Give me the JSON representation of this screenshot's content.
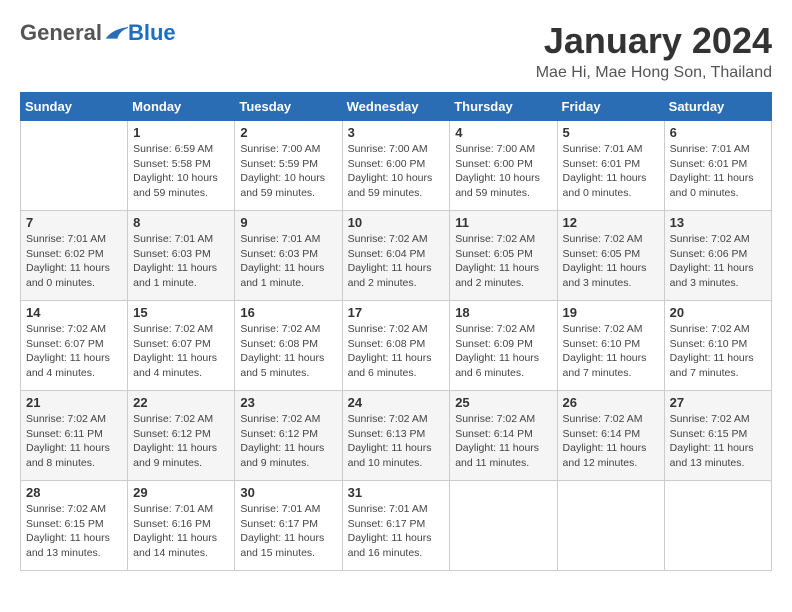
{
  "logo": {
    "general": "General",
    "blue": "Blue"
  },
  "title": "January 2024",
  "subtitle": "Mae Hi, Mae Hong Son, Thailand",
  "days_header": [
    "Sunday",
    "Monday",
    "Tuesday",
    "Wednesday",
    "Thursday",
    "Friday",
    "Saturday"
  ],
  "weeks": [
    [
      {
        "day": "",
        "info": ""
      },
      {
        "day": "1",
        "info": "Sunrise: 6:59 AM\nSunset: 5:58 PM\nDaylight: 10 hours\nand 59 minutes."
      },
      {
        "day": "2",
        "info": "Sunrise: 7:00 AM\nSunset: 5:59 PM\nDaylight: 10 hours\nand 59 minutes."
      },
      {
        "day": "3",
        "info": "Sunrise: 7:00 AM\nSunset: 6:00 PM\nDaylight: 10 hours\nand 59 minutes."
      },
      {
        "day": "4",
        "info": "Sunrise: 7:00 AM\nSunset: 6:00 PM\nDaylight: 10 hours\nand 59 minutes."
      },
      {
        "day": "5",
        "info": "Sunrise: 7:01 AM\nSunset: 6:01 PM\nDaylight: 11 hours\nand 0 minutes."
      },
      {
        "day": "6",
        "info": "Sunrise: 7:01 AM\nSunset: 6:01 PM\nDaylight: 11 hours\nand 0 minutes."
      }
    ],
    [
      {
        "day": "7",
        "info": "Sunrise: 7:01 AM\nSunset: 6:02 PM\nDaylight: 11 hours\nand 0 minutes."
      },
      {
        "day": "8",
        "info": "Sunrise: 7:01 AM\nSunset: 6:03 PM\nDaylight: 11 hours\nand 1 minute."
      },
      {
        "day": "9",
        "info": "Sunrise: 7:01 AM\nSunset: 6:03 PM\nDaylight: 11 hours\nand 1 minute."
      },
      {
        "day": "10",
        "info": "Sunrise: 7:02 AM\nSunset: 6:04 PM\nDaylight: 11 hours\nand 2 minutes."
      },
      {
        "day": "11",
        "info": "Sunrise: 7:02 AM\nSunset: 6:05 PM\nDaylight: 11 hours\nand 2 minutes."
      },
      {
        "day": "12",
        "info": "Sunrise: 7:02 AM\nSunset: 6:05 PM\nDaylight: 11 hours\nand 3 minutes."
      },
      {
        "day": "13",
        "info": "Sunrise: 7:02 AM\nSunset: 6:06 PM\nDaylight: 11 hours\nand 3 minutes."
      }
    ],
    [
      {
        "day": "14",
        "info": "Sunrise: 7:02 AM\nSunset: 6:07 PM\nDaylight: 11 hours\nand 4 minutes."
      },
      {
        "day": "15",
        "info": "Sunrise: 7:02 AM\nSunset: 6:07 PM\nDaylight: 11 hours\nand 4 minutes."
      },
      {
        "day": "16",
        "info": "Sunrise: 7:02 AM\nSunset: 6:08 PM\nDaylight: 11 hours\nand 5 minutes."
      },
      {
        "day": "17",
        "info": "Sunrise: 7:02 AM\nSunset: 6:08 PM\nDaylight: 11 hours\nand 6 minutes."
      },
      {
        "day": "18",
        "info": "Sunrise: 7:02 AM\nSunset: 6:09 PM\nDaylight: 11 hours\nand 6 minutes."
      },
      {
        "day": "19",
        "info": "Sunrise: 7:02 AM\nSunset: 6:10 PM\nDaylight: 11 hours\nand 7 minutes."
      },
      {
        "day": "20",
        "info": "Sunrise: 7:02 AM\nSunset: 6:10 PM\nDaylight: 11 hours\nand 7 minutes."
      }
    ],
    [
      {
        "day": "21",
        "info": "Sunrise: 7:02 AM\nSunset: 6:11 PM\nDaylight: 11 hours\nand 8 minutes."
      },
      {
        "day": "22",
        "info": "Sunrise: 7:02 AM\nSunset: 6:12 PM\nDaylight: 11 hours\nand 9 minutes."
      },
      {
        "day": "23",
        "info": "Sunrise: 7:02 AM\nSunset: 6:12 PM\nDaylight: 11 hours\nand 9 minutes."
      },
      {
        "day": "24",
        "info": "Sunrise: 7:02 AM\nSunset: 6:13 PM\nDaylight: 11 hours\nand 10 minutes."
      },
      {
        "day": "25",
        "info": "Sunrise: 7:02 AM\nSunset: 6:14 PM\nDaylight: 11 hours\nand 11 minutes."
      },
      {
        "day": "26",
        "info": "Sunrise: 7:02 AM\nSunset: 6:14 PM\nDaylight: 11 hours\nand 12 minutes."
      },
      {
        "day": "27",
        "info": "Sunrise: 7:02 AM\nSunset: 6:15 PM\nDaylight: 11 hours\nand 13 minutes."
      }
    ],
    [
      {
        "day": "28",
        "info": "Sunrise: 7:02 AM\nSunset: 6:15 PM\nDaylight: 11 hours\nand 13 minutes."
      },
      {
        "day": "29",
        "info": "Sunrise: 7:01 AM\nSunset: 6:16 PM\nDaylight: 11 hours\nand 14 minutes."
      },
      {
        "day": "30",
        "info": "Sunrise: 7:01 AM\nSunset: 6:17 PM\nDaylight: 11 hours\nand 15 minutes."
      },
      {
        "day": "31",
        "info": "Sunrise: 7:01 AM\nSunset: 6:17 PM\nDaylight: 11 hours\nand 16 minutes."
      },
      {
        "day": "",
        "info": ""
      },
      {
        "day": "",
        "info": ""
      },
      {
        "day": "",
        "info": ""
      }
    ]
  ]
}
